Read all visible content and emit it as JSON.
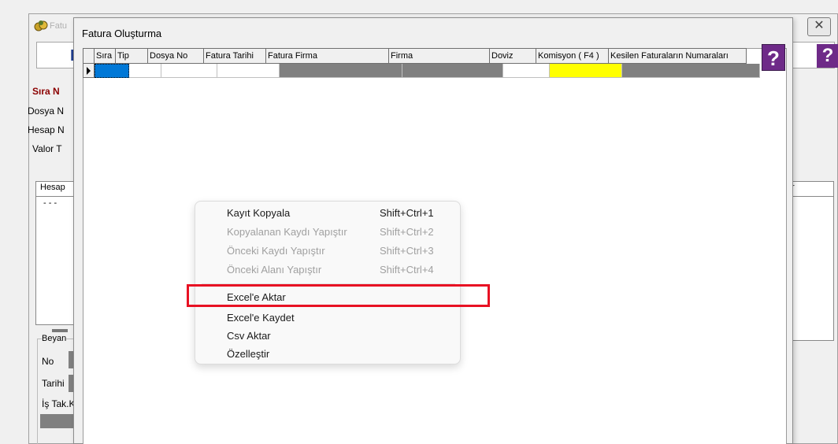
{
  "background_window": {
    "title": "Fatu",
    "topbar_letter": "K",
    "help_label": "?",
    "close_label": "✕",
    "labels": {
      "sira": "Sıra N",
      "dosya": "Dosya N",
      "hesap": "Hesap N",
      "valor": "Valor T",
      "grid_header": "Hesap",
      "grid_row": "- - -",
      "right_header": "r",
      "beyan": "Beyan",
      "no": "No",
      "tarihi": "Tarihi",
      "is_tak": "İş Tak.K"
    }
  },
  "window": {
    "title": "Fatura Oluşturma",
    "help_label": "?"
  },
  "grid": {
    "columns": [
      "Sıra No",
      "Tip",
      "Dosya No",
      "Fatura Tarihi",
      "Fatura Firma",
      "Firma",
      "Doviz",
      "Komisyon ( F4 )",
      "Kesilen Faturaların Numaraları"
    ],
    "colors": {
      "selected": "#0078d7",
      "readonly": "#808080",
      "komisyon": "#ffff00",
      "editable": "#ffffff"
    }
  },
  "context_menu": {
    "items": [
      {
        "label": "Kayıt Kopyala",
        "shortcut": "Shift+Ctrl+1",
        "enabled": true
      },
      {
        "label": "Kopyalanan Kaydı Yapıştır",
        "shortcut": "Shift+Ctrl+2",
        "enabled": false
      },
      {
        "label": "Önceki Kaydı Yapıştır",
        "shortcut": "Shift+Ctrl+3",
        "enabled": false
      },
      {
        "label": "Önceki Alanı Yapıştır",
        "shortcut": "Shift+Ctrl+4",
        "enabled": false
      },
      {
        "label": "Excel'e Aktar",
        "shortcut": "",
        "enabled": true,
        "highlighted": true
      },
      {
        "label": "Excel'e Kaydet",
        "shortcut": "",
        "enabled": true
      },
      {
        "label": "Csv Aktar",
        "shortcut": "",
        "enabled": true
      },
      {
        "label": "Özelleştir",
        "shortcut": "",
        "enabled": true
      }
    ],
    "highlight_color": "#e81123"
  }
}
